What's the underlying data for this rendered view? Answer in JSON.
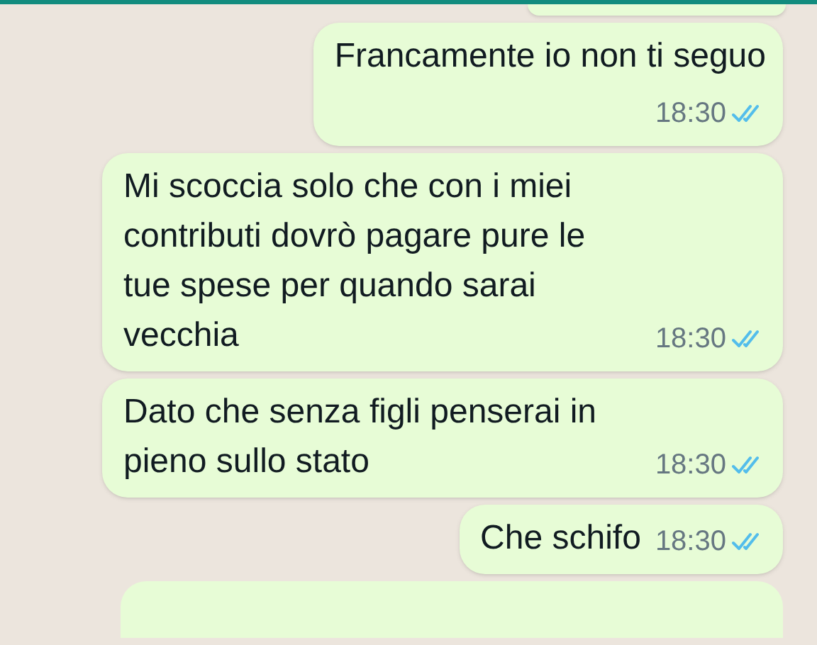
{
  "messages": [
    {
      "kind": "cut_top"
    },
    {
      "kind": "text",
      "text": "Francamente io non ti seguo",
      "time": "18:30",
      "read": true,
      "time_below": true
    },
    {
      "kind": "text",
      "text": "Mi scoccia solo che con i miei contributi dovrò pagare pure le tue spese per quando sarai vecchia",
      "time": "18:30",
      "read": true,
      "time_below": false
    },
    {
      "kind": "text",
      "text": "Dato che senza figli penserai in pieno sullo stato",
      "time": "18:30",
      "read": true,
      "time_below": false
    },
    {
      "kind": "text",
      "text": "Che schifo",
      "time": "18:30",
      "read": true,
      "time_below": false
    },
    {
      "kind": "cut_bottom"
    }
  ]
}
